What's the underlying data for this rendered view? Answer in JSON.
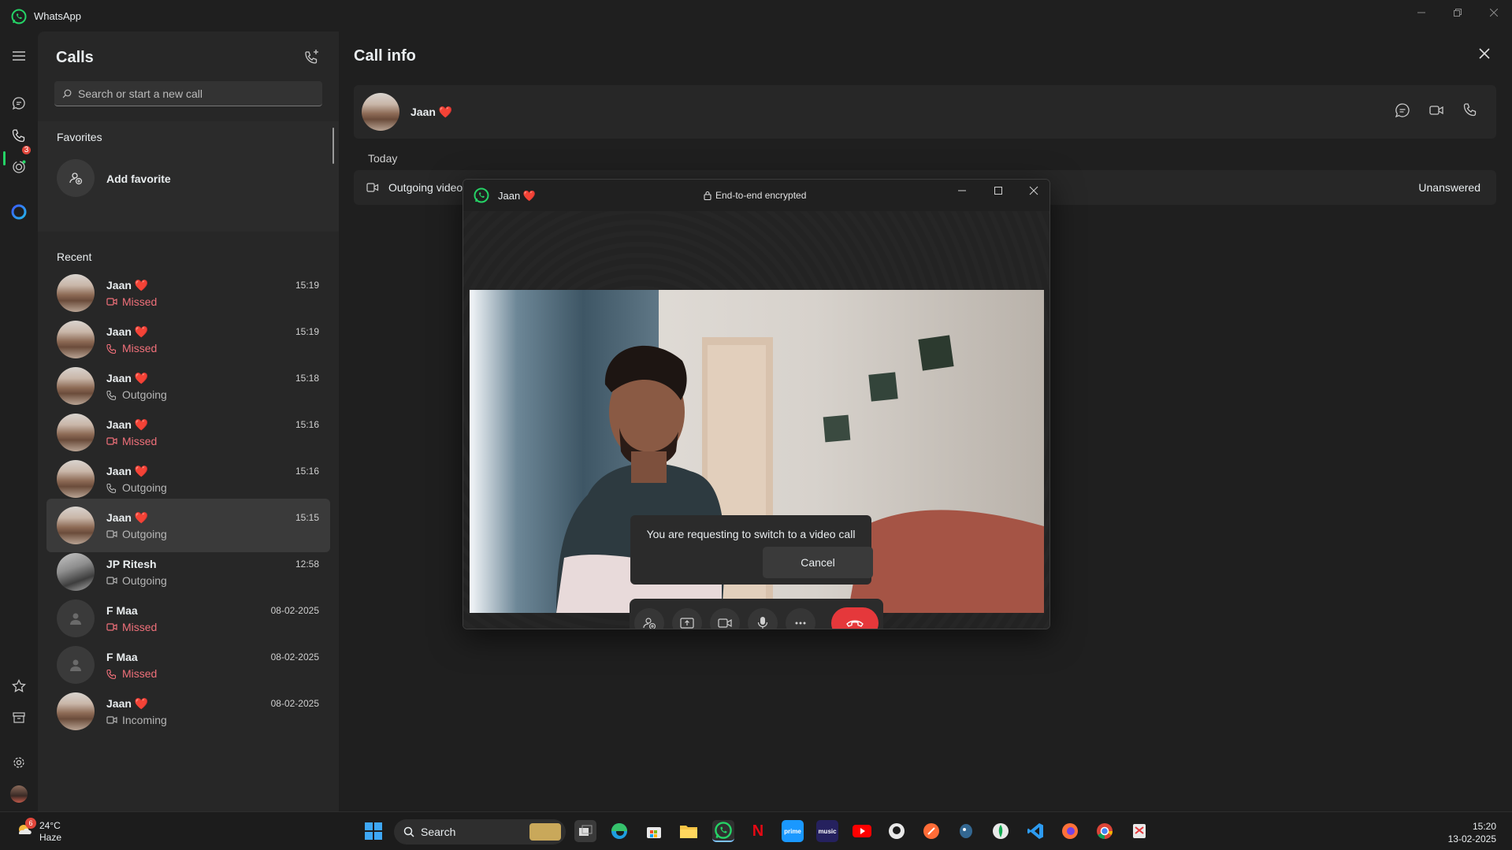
{
  "app": {
    "title": "WhatsApp"
  },
  "rail": {
    "calls_badge": "3"
  },
  "calls_panel": {
    "title": "Calls",
    "search_placeholder": "Search or start a new call",
    "favorites_title": "Favorites",
    "add_favorite": "Add favorite",
    "recent_title": "Recent",
    "items": [
      {
        "name": "Jaan ❤️",
        "status": "Missed",
        "kind": "video",
        "time": "15:19",
        "missed": true
      },
      {
        "name": "Jaan ❤️",
        "status": "Missed",
        "kind": "voice",
        "time": "15:19",
        "missed": true
      },
      {
        "name": "Jaan ❤️",
        "status": "Outgoing",
        "kind": "voice",
        "time": "15:18",
        "missed": false
      },
      {
        "name": "Jaan ❤️",
        "status": "Missed",
        "kind": "video",
        "time": "15:16",
        "missed": true
      },
      {
        "name": "Jaan ❤️",
        "status": "Outgoing",
        "kind": "voice",
        "time": "15:16",
        "missed": false
      },
      {
        "name": "Jaan ❤️",
        "status": "Outgoing",
        "kind": "video",
        "time": "15:15",
        "missed": false,
        "selected": true
      },
      {
        "name": "JP Ritesh",
        "status": "Outgoing",
        "kind": "video",
        "time": "12:58",
        "missed": false
      },
      {
        "name": "F Maa",
        "status": "Missed",
        "kind": "video",
        "time": "08-02-2025",
        "missed": true
      },
      {
        "name": "F Maa",
        "status": "Missed",
        "kind": "voice",
        "time": "08-02-2025",
        "missed": true
      },
      {
        "name": "Jaan ❤️",
        "status": "Incoming",
        "kind": "video",
        "time": "08-02-2025",
        "missed": false
      }
    ]
  },
  "call_info": {
    "title": "Call info",
    "contact_name": "Jaan ❤️",
    "day": "Today",
    "call_label": "Outgoing video call",
    "call_status": "Unanswered"
  },
  "call_window": {
    "contact_name": "Jaan ❤️",
    "encryption": "End-to-end encrypted",
    "prompt_text": "You are requesting to switch to a video call",
    "cancel_label": "Cancel"
  },
  "taskbar": {
    "temperature": "24°C",
    "weather": "Haze",
    "weather_badge": "6",
    "search_label": "Search",
    "time": "15:20",
    "date": "13-02-2025"
  },
  "colors": {
    "accent": "#25d366",
    "missed": "#f0707a",
    "end_call": "#e5383b",
    "badge": "#e0463b"
  }
}
